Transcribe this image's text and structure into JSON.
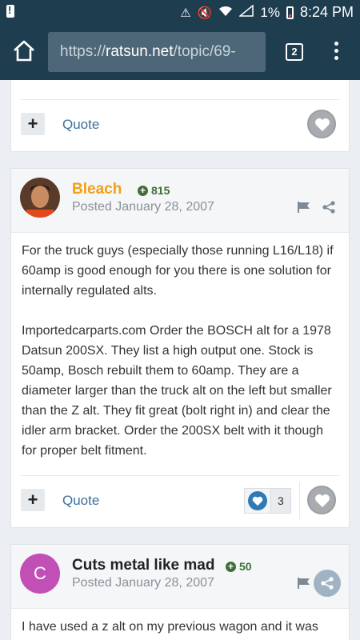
{
  "status_bar": {
    "battery_percent": "1%",
    "time": "8:24 PM",
    "icons": [
      "notification-icon",
      "nfc-icon",
      "mute-icon",
      "wifi-icon",
      "signal-icon",
      "battery-icon"
    ]
  },
  "browser": {
    "url_scheme": "https://",
    "url_host": "ratsun.net",
    "url_path": "/topic/69-",
    "tab_count": "2"
  },
  "prev_post": {
    "quote_label": "Quote"
  },
  "posts": [
    {
      "author": "Bleach",
      "author_color": "#f0a016",
      "reputation": "815",
      "posted": "Posted January 28, 2007",
      "paragraphs": [
        "For the truck guys (especially those running L16/L18) if 60amp is good enough for you there is one solution for internally regulated alts.",
        "Importedcarparts.com Order the BOSCH alt for a 1978 Datsun 200SX. They list a high output one. Stock is 50amp, Bosch rebuilt them to 60amp. They are a diameter larger than the truck alt on the left but smaller than the Z alt. They fit great (bolt right in) and clear the idler arm bracket. Order the 200SX belt with it though for proper belt fitment."
      ],
      "quote_label": "Quote",
      "reaction_count": "3"
    },
    {
      "author": "Cuts metal like mad",
      "author_color": "#222222",
      "avatar_letter": "C",
      "avatar_color": "#c24fb5",
      "reputation": "50",
      "posted": "Posted January 28, 2007",
      "paragraphs": [
        "I have used a z alt on my previous wagon and it was"
      ]
    }
  ]
}
